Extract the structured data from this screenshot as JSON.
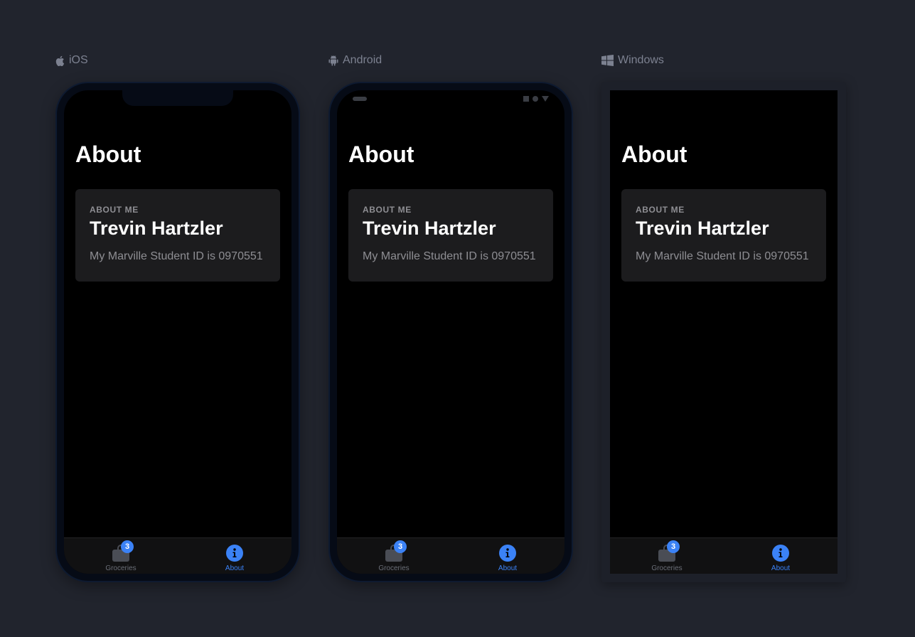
{
  "platforms": [
    {
      "label": "iOS",
      "icon": "apple-icon",
      "frame_type": "phone-notch"
    },
    {
      "label": "Android",
      "icon": "android-icon",
      "frame_type": "phone-punch"
    },
    {
      "label": "Windows",
      "icon": "windows-icon",
      "frame_type": "window"
    }
  ],
  "screen": {
    "title": "About",
    "card": {
      "label": "ABOUT ME",
      "name": "Trevin Hartzler",
      "text": "My Marville Student ID is 0970551"
    },
    "tabs": [
      {
        "label": "Groceries",
        "icon": "shopping-bag-icon",
        "badge": "3",
        "active": false
      },
      {
        "label": "About",
        "icon": "info-icon",
        "badge": "",
        "active": true
      }
    ]
  },
  "colors": {
    "background": "#21242d",
    "accent": "#3b82f6",
    "card": "#1c1c1e",
    "muted_text": "#8e8e93",
    "inactive_tab": "#6b6f78"
  }
}
